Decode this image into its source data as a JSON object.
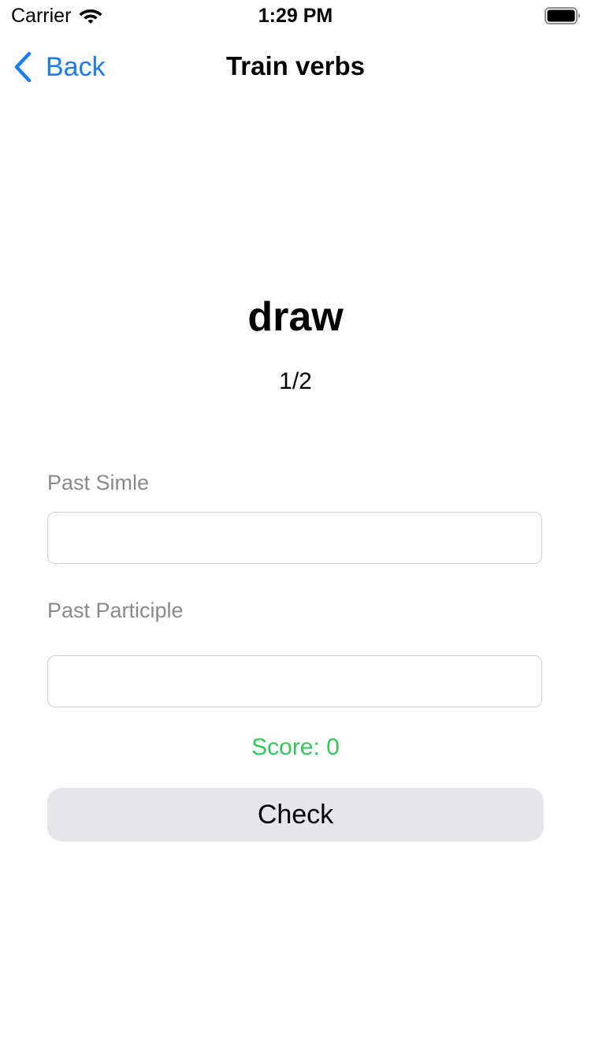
{
  "status_bar": {
    "carrier": "Carrier",
    "time": "1:29 PM",
    "wifi_icon": "wifi-icon",
    "battery_icon": "battery-icon"
  },
  "nav": {
    "back_label": "Back",
    "back_icon": "chevron-left-icon",
    "title": "Train verbs"
  },
  "card": {
    "verb": "draw",
    "progress": "1/2"
  },
  "form": {
    "past_simple_label": "Past Simle",
    "past_simple_value": "",
    "past_participle_label": "Past Participle",
    "past_participle_value": ""
  },
  "score_text": "Score: 0",
  "check_label": "Check",
  "colors": {
    "accent": "#1a7cf5",
    "score": "#34c759",
    "button_bg": "#e5e5ea",
    "label": "#8a8a8e"
  }
}
